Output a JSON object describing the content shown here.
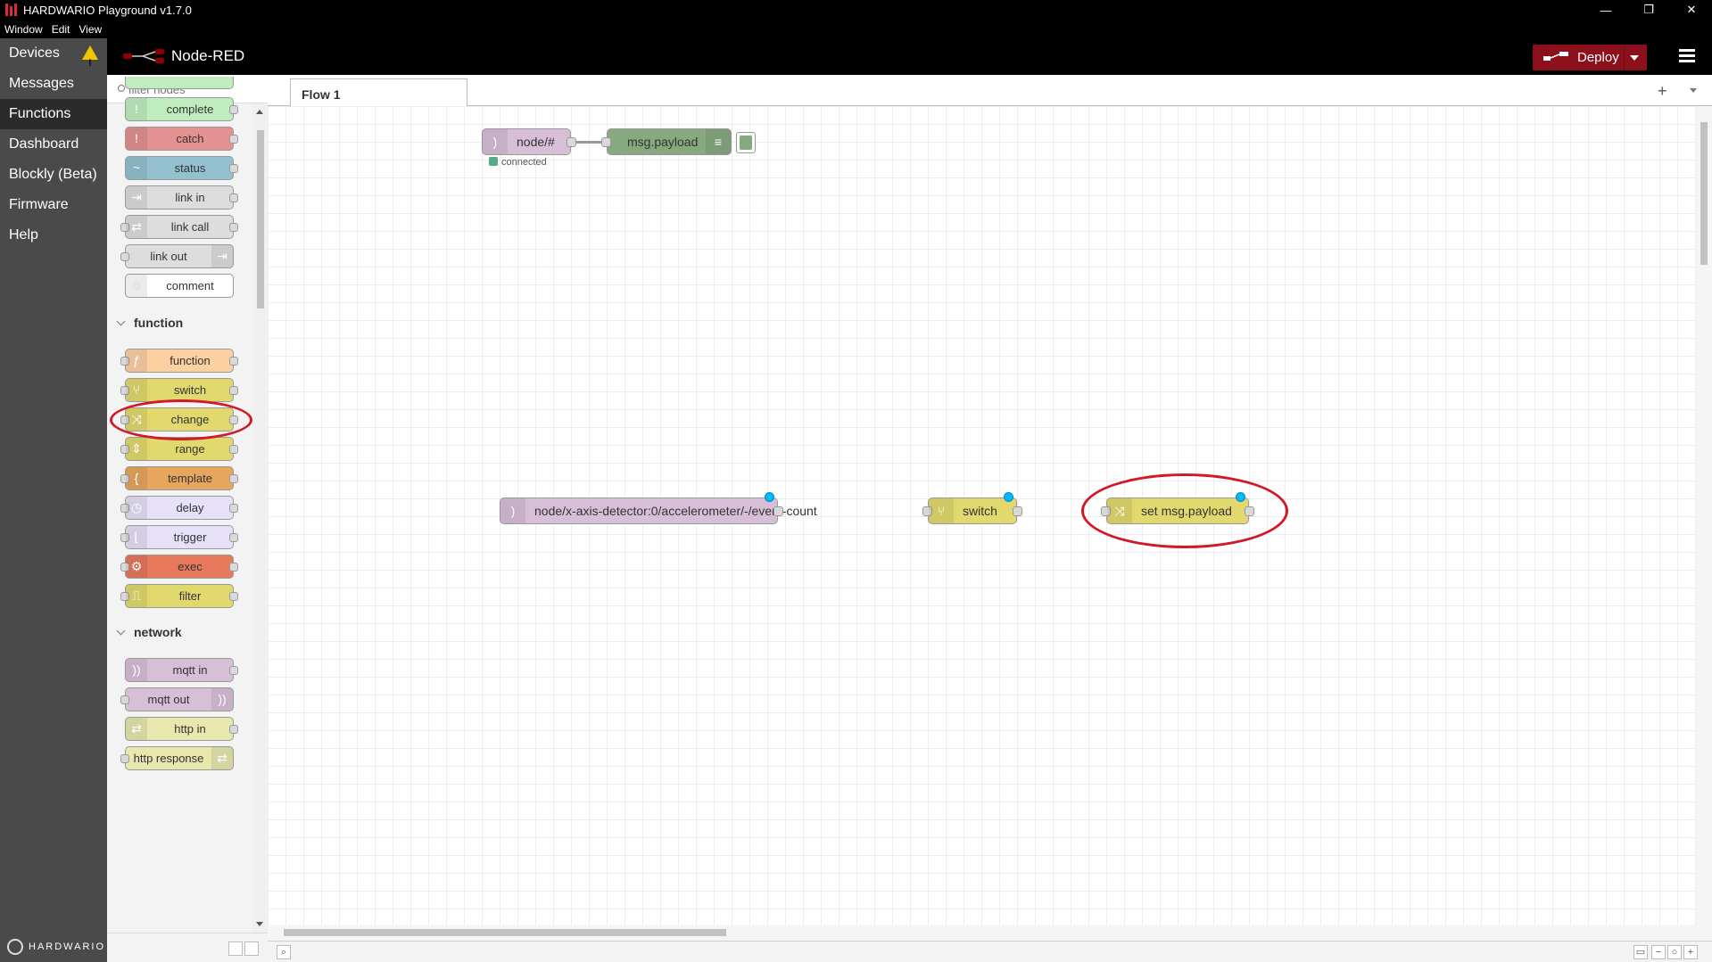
{
  "window": {
    "title": "HARDWARIO Playground v1.7.0",
    "controls": [
      "—",
      "❐",
      "✕"
    ]
  },
  "menubar": [
    "Window",
    "Edit",
    "View"
  ],
  "appnav": {
    "items": [
      {
        "label": "Devices",
        "warning": true
      },
      {
        "label": "Messages"
      },
      {
        "label": "Functions",
        "active": true
      },
      {
        "label": "Dashboard"
      },
      {
        "label": "Blockly (Beta)"
      },
      {
        "label": "Firmware"
      },
      {
        "label": "Help"
      }
    ],
    "brand": "HARDWARIO"
  },
  "header": {
    "title": "Node-RED",
    "deploy_label": "Deploy",
    "deploy_color": "#8c101c"
  },
  "palette": {
    "filter_placeholder": "filter nodes",
    "common_nodes": [
      {
        "label": "complete",
        "color": "#c0edc0",
        "icon": "!"
      },
      {
        "label": "catch",
        "color": "#e49191",
        "icon": "!"
      },
      {
        "label": "status",
        "color": "#94c1d0",
        "icon": "~"
      },
      {
        "label": "link in",
        "color": "#dddddd",
        "icon": "⇥"
      },
      {
        "label": "link call",
        "color": "#dddddd",
        "icon": "⇄"
      },
      {
        "label": "link out",
        "color": "#dddddd",
        "icon": "⇥"
      },
      {
        "label": "comment",
        "color": "#ffffff",
        "icon": "◌"
      }
    ],
    "categories": {
      "function": "function",
      "network": "network"
    },
    "function_nodes": [
      {
        "label": "function",
        "color": "#fdd0a2",
        "icon": "ƒ"
      },
      {
        "label": "switch",
        "color": "#e2d96e",
        "icon": "⑂"
      },
      {
        "label": "change",
        "color": "#e2d96e",
        "icon": "⤨"
      },
      {
        "label": "range",
        "color": "#e2d96e",
        "icon": "⇕"
      },
      {
        "label": "template",
        "color": "#e7a65e",
        "icon": "{"
      },
      {
        "label": "delay",
        "color": "#e6e0f8",
        "icon": "◷"
      },
      {
        "label": "trigger",
        "color": "#e6e0f8",
        "icon": "⌊"
      },
      {
        "label": "exec",
        "color": "#e8785c",
        "icon": "⚙"
      },
      {
        "label": "filter",
        "color": "#e2d96e",
        "icon": "⎍"
      }
    ],
    "network_nodes": [
      {
        "label": "mqtt in",
        "color": "#d8bfd8",
        "icon": "))"
      },
      {
        "label": "mqtt out",
        "color": "#d8bfd8",
        "icon": "))"
      },
      {
        "label": "http in",
        "color": "#e7e7ae",
        "icon": "⇄"
      },
      {
        "label": "http response",
        "color": "#e7e7ae",
        "icon": "⇄"
      }
    ]
  },
  "workspace": {
    "tab": "Flow 1",
    "nodes": {
      "mqtt_in": {
        "label": "node/#",
        "color": "#d8bfd8"
      },
      "debug": {
        "label": "msg.payload",
        "color": "#87a980"
      },
      "status_text": "connected",
      "mqtt_event": {
        "label": "node/x-axis-detector:0/accelerometer/-/event-count",
        "color": "#d8bfd8"
      },
      "switch": {
        "label": "switch",
        "color": "#e2d96e"
      },
      "change": {
        "label": "set msg.payload",
        "color": "#e2d96e"
      }
    },
    "highlight_color": "#d01a25"
  }
}
